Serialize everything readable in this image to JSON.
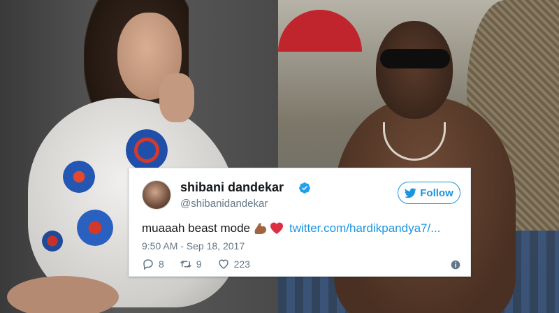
{
  "tweet": {
    "user_name": "shibani dandekar",
    "handle": "@shibanidandekar",
    "follow_label": "Follow",
    "text": "muaaah beast mode",
    "emojis": [
      "flexed-biceps-emoji",
      "red-heart-emoji"
    ],
    "link": "twitter.com/hardikpandya7/...",
    "timestamp": "9:50 AM - Sep 18, 2017",
    "replies": "8",
    "retweets": "9",
    "likes": "223"
  },
  "colors": {
    "accent": "#1b95e0",
    "text": "#14171a",
    "muted": "#657786",
    "heart": "#e0245e"
  },
  "icons": [
    "verified-badge-icon",
    "twitter-bird-icon",
    "reply-icon",
    "retweet-icon",
    "like-icon",
    "info-icon"
  ]
}
